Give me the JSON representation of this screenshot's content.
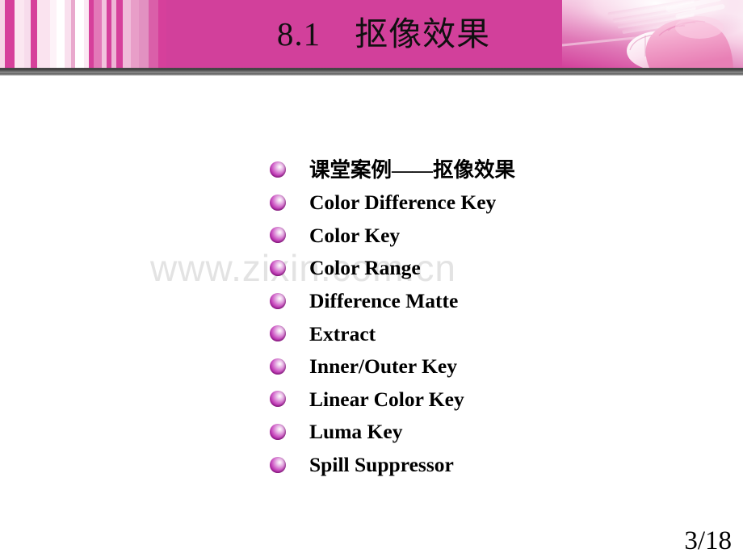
{
  "slide": {
    "title": "8.1　抠像效果",
    "page_number": "3/18",
    "watermark": "www.zixin.com.cn",
    "colors": {
      "banner_pink": "#d2409b",
      "bullet_purple": "#a61f9c",
      "divider_gray": "#4d4d4d",
      "text_black": "#000000",
      "watermark_gray": "#e3e3e3"
    }
  },
  "header": {
    "title": "8.1　抠像效果",
    "decoration_name": "vertical-pink-stripes",
    "photo_name": "hand-on-mouse-photo"
  },
  "bullets": [
    {
      "label": "课堂案例——抠像效果",
      "script": "cjk"
    },
    {
      "label": "Color Difference Key",
      "script": "latin"
    },
    {
      "label": "Color Key",
      "script": "latin"
    },
    {
      "label": "Color Range",
      "script": "latin"
    },
    {
      "label": "Difference Matte",
      "script": "latin"
    },
    {
      "label": "Extract",
      "script": "latin"
    },
    {
      "label": "Inner/Outer Key",
      "script": "latin"
    },
    {
      "label": "Linear Color Key",
      "script": "latin"
    },
    {
      "label": "Luma Key",
      "script": "latin"
    },
    {
      "label": "Spill Suppressor",
      "script": "latin"
    }
  ]
}
